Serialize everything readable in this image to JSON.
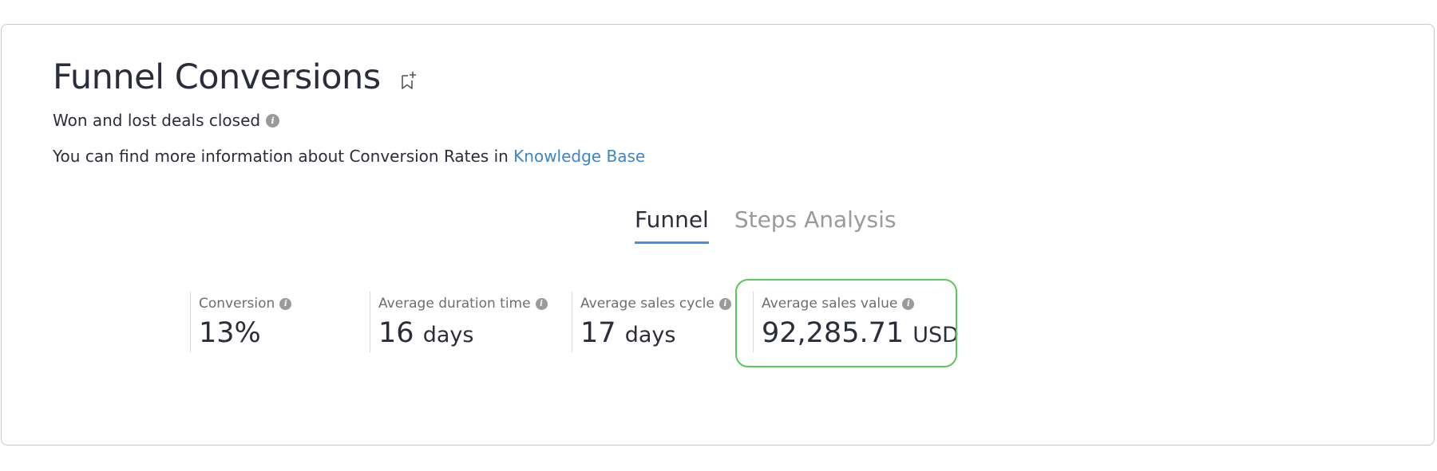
{
  "header": {
    "title": "Funnel Conversions",
    "subtitle": "Won and lost deals closed",
    "info_text": "You can find more information about Conversion Rates in ",
    "info_link": "Knowledge Base"
  },
  "icons": {
    "bookmark": "bookmark-add-icon",
    "info": "info-icon"
  },
  "tabs": [
    {
      "label": "Funnel",
      "active": true
    },
    {
      "label": "Steps Analysis",
      "active": false
    }
  ],
  "metrics": [
    {
      "label": "Conversion",
      "value": "13%",
      "unit": ""
    },
    {
      "label": "Average duration time",
      "value": "16",
      "unit": "days"
    },
    {
      "label": "Average sales cycle",
      "value": "17",
      "unit": "days"
    },
    {
      "label": "Average sales value",
      "value": "92,285.71",
      "unit": "USD"
    }
  ],
  "colors": {
    "accent": "#4a90e2",
    "link": "#3d86c6",
    "highlight": "#5ac85a",
    "text": "#2b2d3a",
    "muted": "#9a9a9a"
  }
}
